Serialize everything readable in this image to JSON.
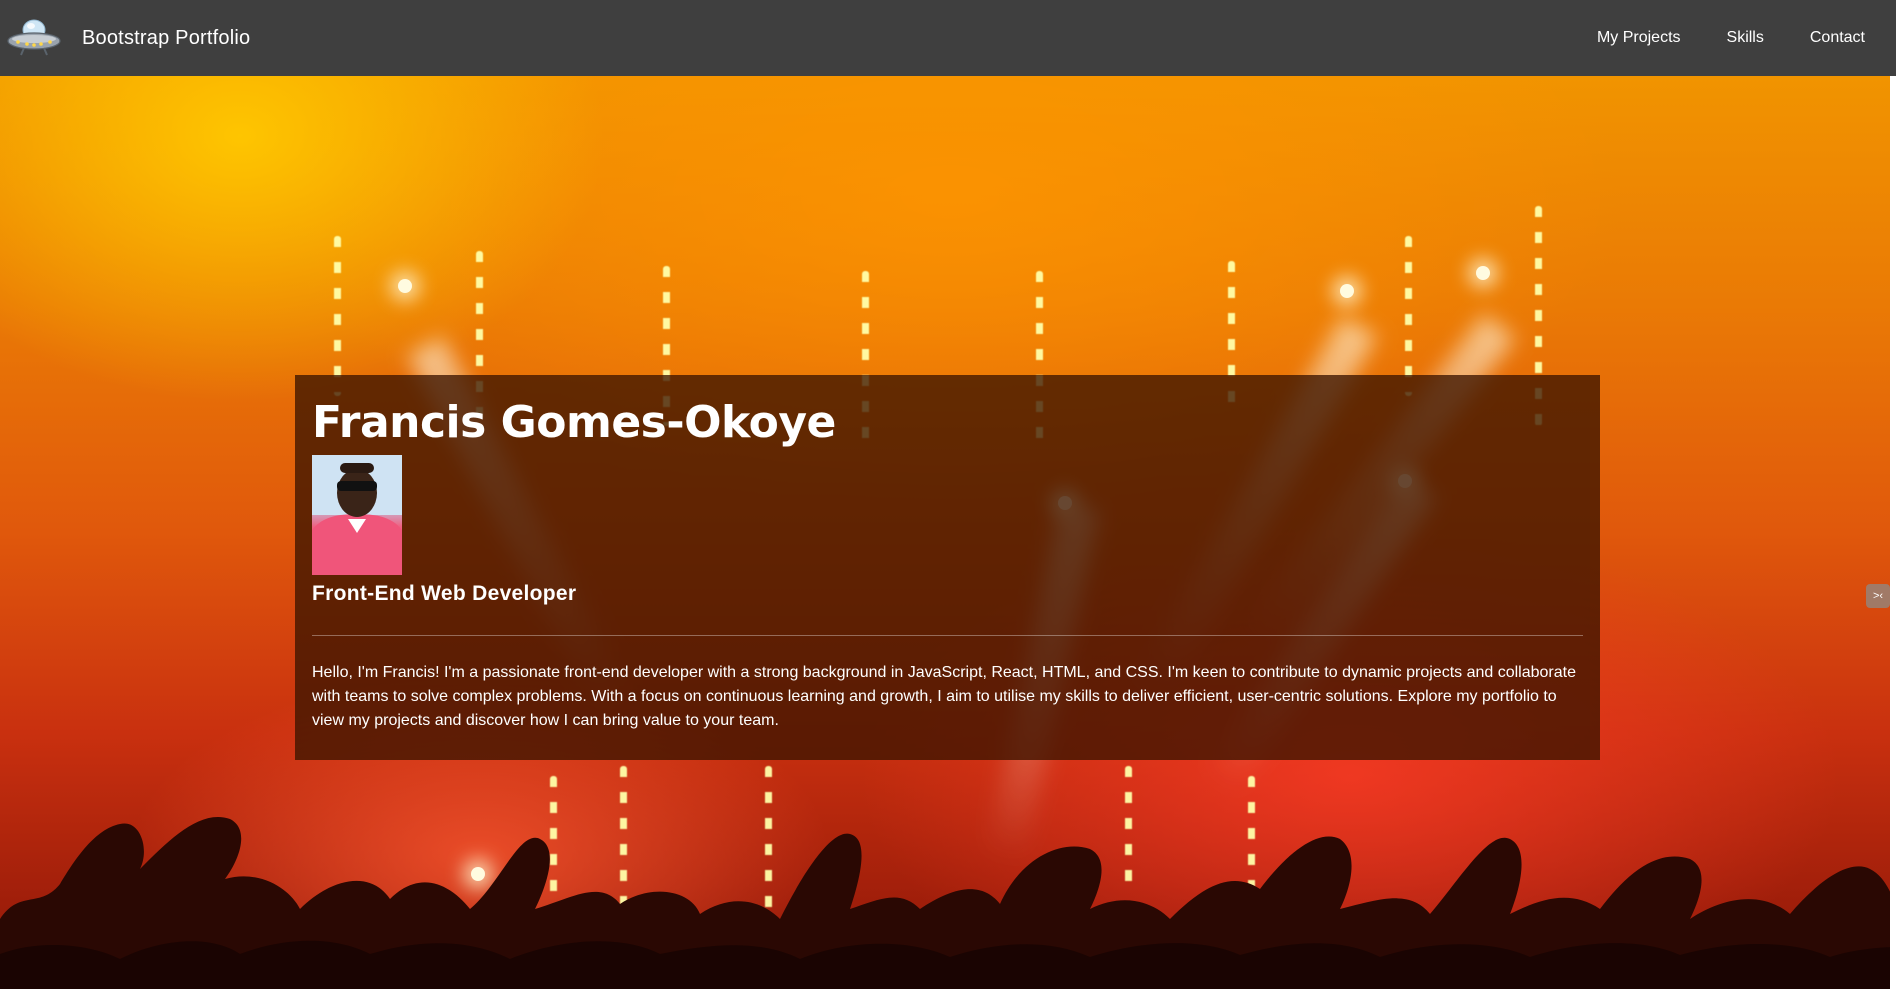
{
  "navbar": {
    "brand_icon": "ufo-icon",
    "brand_text": "Bootstrap Portfolio",
    "links": [
      {
        "label": "My Projects"
      },
      {
        "label": "Skills"
      },
      {
        "label": "Contact"
      }
    ],
    "background": "#3f3f3f"
  },
  "hero": {
    "background_theme": "concert-stage-orange",
    "card_background": "rgba(60,20,0,0.78)"
  },
  "intro": {
    "name": "Francis Gomes-Okoye",
    "avatar": "profile-photo",
    "role": "Front-End Web Developer",
    "bio": "Hello, I'm Francis! I'm a passionate front-end developer with a strong background in JavaScript, React, HTML, and CSS. I'm keen to contribute to dynamic projects and collaborate with teams to solve complex problems. With a focus on continuous learning and growth, I aim to utilise my skills to deliver efficient, user-centric solutions. Explore my portfolio to view my projects and discover how I can bring value to your team."
  },
  "edge_tab": {
    "icon": "sidebar-toggle-icon",
    "glyph": ">‹"
  }
}
